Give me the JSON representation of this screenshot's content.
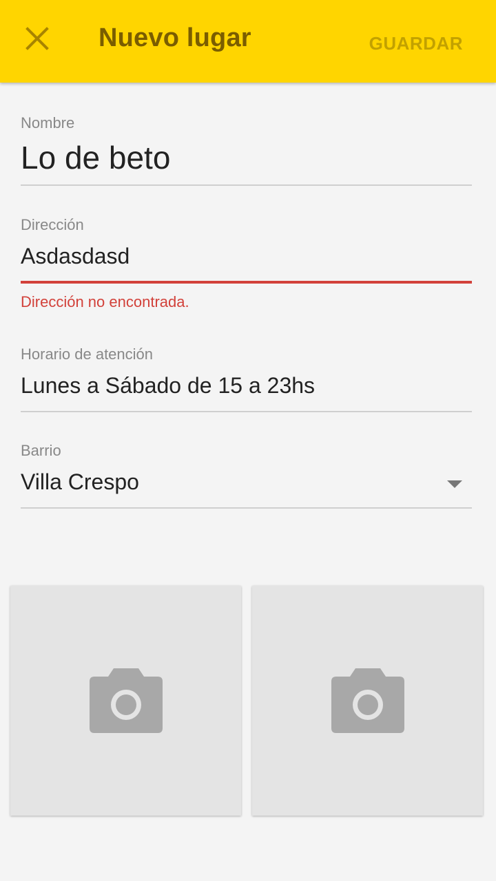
{
  "appbar": {
    "title": "Nuevo lugar",
    "close_icon": "close-icon",
    "save_label": "GUARDAR"
  },
  "form": {
    "nombre": {
      "label": "Nombre",
      "value": "Lo de beto"
    },
    "direccion": {
      "label": "Dirección",
      "value": "Asdasdasd",
      "error": "Dirección no encontrada."
    },
    "horario": {
      "label": "Horario de atención",
      "value": "Lunes a Sábado de 15 a 23hs"
    },
    "barrio": {
      "label": "Barrio",
      "value": "Villa Crespo",
      "dropdown_icon": "dropdown-arrow-icon"
    }
  },
  "photos": [
    {
      "icon": "camera-icon"
    },
    {
      "icon": "camera-icon"
    }
  ],
  "colors": {
    "appbar": "#ffd500",
    "title": "#7a5d00",
    "save": "#c2a100",
    "error": "#d2413a",
    "background": "#f4f4f4"
  }
}
